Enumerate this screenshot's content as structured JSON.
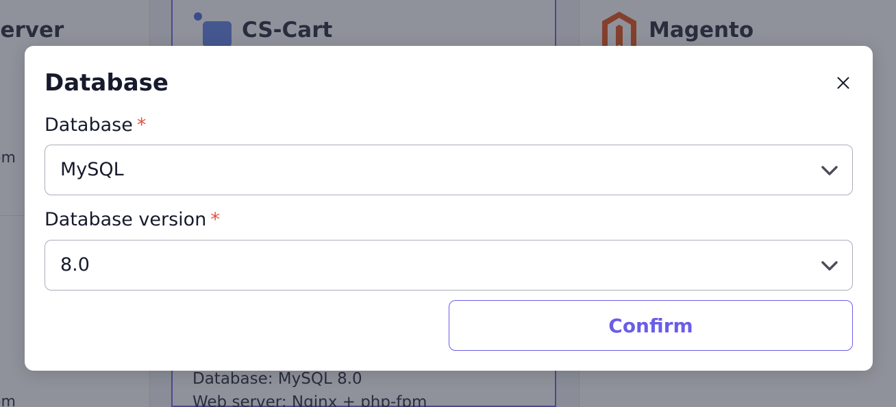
{
  "background": {
    "columns": [
      {
        "title": "server",
        "fragments": [
          "om",
          "om"
        ]
      },
      {
        "title": "CS-Cart",
        "details": [
          "Database: MySQL 8.0",
          "Web server: Nginx + php-fpm"
        ]
      },
      {
        "title": "Magento"
      }
    ]
  },
  "modal": {
    "title": "Database",
    "fields": [
      {
        "label": "Database",
        "required_mark": "*",
        "value": "MySQL"
      },
      {
        "label": "Database version",
        "required_mark": "*",
        "value": "8.0"
      }
    ],
    "confirm_label": "Confirm"
  },
  "colors": {
    "accent": "#6a5de8",
    "required": "#e0523c",
    "overlay": "rgba(24, 27, 46, 0.48)"
  },
  "icons": [
    "cs-cart-logo-icon",
    "magento-logo-icon",
    "close-icon",
    "chevron-down-icon"
  ]
}
